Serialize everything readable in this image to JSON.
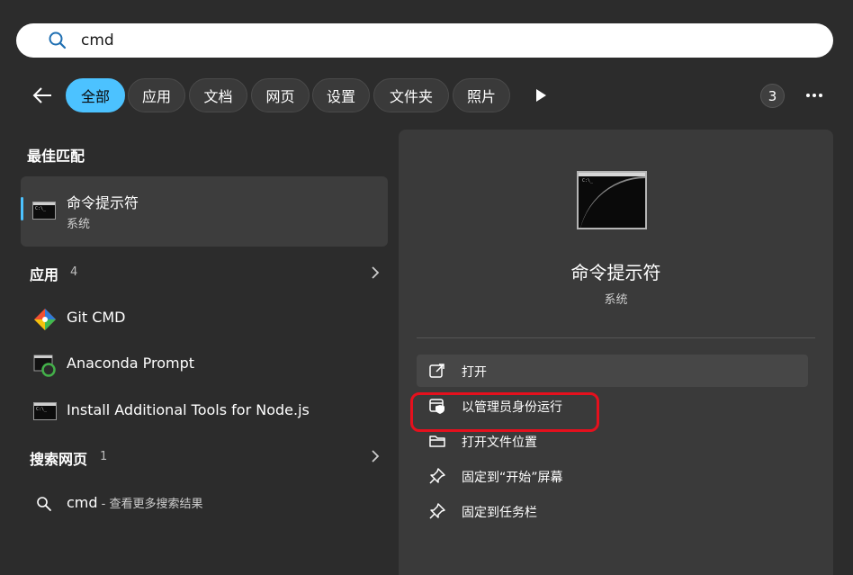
{
  "search": {
    "value": "cmd"
  },
  "filters": {
    "chips": [
      {
        "label": "全部",
        "active": true
      },
      {
        "label": "应用"
      },
      {
        "label": "文档"
      },
      {
        "label": "网页"
      },
      {
        "label": "设置"
      },
      {
        "label": "文件夹"
      },
      {
        "label": "照片"
      }
    ],
    "result_count": "3"
  },
  "best_match": {
    "heading": "最佳匹配",
    "title": "命令提示符",
    "subtitle": "系统"
  },
  "apps": {
    "heading": "应用",
    "count": "4",
    "items": [
      {
        "label": "Git CMD",
        "icon": "git-icon"
      },
      {
        "label": "Anaconda Prompt",
        "icon": "anaconda-prompt-icon"
      },
      {
        "label": "Install Additional Tools for Node.js",
        "icon": "cmd-icon"
      }
    ]
  },
  "web": {
    "heading": "搜索网页",
    "count": "1",
    "query": "cmd",
    "hint": " - 查看更多搜索结果"
  },
  "details": {
    "title": "命令提示符",
    "subtitle": "系统",
    "actions": [
      {
        "label": "打开",
        "icon": "open-external-icon"
      },
      {
        "label": "以管理员身份运行",
        "icon": "run-as-admin-icon"
      },
      {
        "label": "打开文件位置",
        "icon": "folder-icon"
      },
      {
        "label": "固定到“开始”屏幕",
        "icon": "pin-icon"
      },
      {
        "label": "固定到任务栏",
        "icon": "pin-icon"
      }
    ]
  },
  "colors": {
    "accent": "#4cc2ff",
    "highlight_box": "#e5101d"
  }
}
